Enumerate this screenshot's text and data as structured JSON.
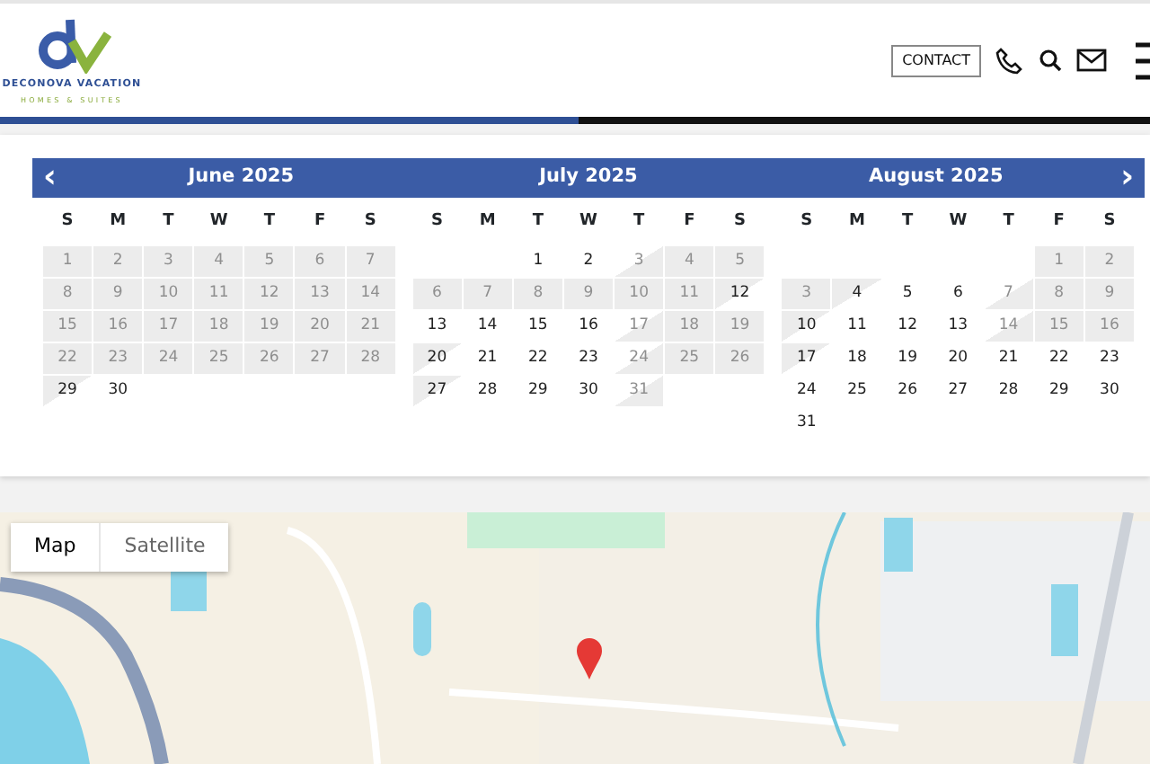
{
  "header": {
    "brand": "DECONOVA VACATION",
    "tagline": "HOMES & SUITES",
    "contact_button": "CONTACT"
  },
  "calendar": {
    "prev": "‹",
    "next": "›",
    "months": [
      {
        "title": "June 2025",
        "weekdays": [
          "S",
          "M",
          "T",
          "W",
          "T",
          "F",
          "S"
        ],
        "weeks": [
          {
            "days": [
              {
                "day": "1",
                "kind": "booked"
              },
              {
                "day": "2",
                "kind": "booked"
              },
              {
                "day": "3",
                "kind": "booked"
              },
              {
                "day": "4",
                "kind": "booked"
              },
              {
                "day": "5",
                "kind": "booked"
              },
              {
                "day": "6",
                "kind": "booked"
              },
              {
                "day": "7",
                "kind": "booked"
              }
            ]
          },
          {
            "days": [
              {
                "day": "8",
                "kind": "booked"
              },
              {
                "day": "9",
                "kind": "booked"
              },
              {
                "day": "10",
                "kind": "booked"
              },
              {
                "day": "11",
                "kind": "booked"
              },
              {
                "day": "12",
                "kind": "booked"
              },
              {
                "day": "13",
                "kind": "booked"
              },
              {
                "day": "14",
                "kind": "booked"
              }
            ]
          },
          {
            "days": [
              {
                "day": "15",
                "kind": "booked"
              },
              {
                "day": "16",
                "kind": "booked"
              },
              {
                "day": "17",
                "kind": "booked"
              },
              {
                "day": "18",
                "kind": "booked"
              },
              {
                "day": "19",
                "kind": "booked"
              },
              {
                "day": "20",
                "kind": "booked"
              },
              {
                "day": "21",
                "kind": "booked"
              }
            ]
          },
          {
            "days": [
              {
                "day": "22",
                "kind": "booked"
              },
              {
                "day": "23",
                "kind": "booked"
              },
              {
                "day": "24",
                "kind": "booked"
              },
              {
                "day": "25",
                "kind": "booked"
              },
              {
                "day": "26",
                "kind": "booked"
              },
              {
                "day": "27",
                "kind": "booked"
              },
              {
                "day": "28",
                "kind": "booked"
              }
            ]
          },
          {
            "days": [
              {
                "day": "29",
                "kind": "checkout"
              },
              {
                "day": "30",
                "kind": "available"
              }
            ]
          }
        ]
      },
      {
        "title": "July 2025",
        "weekdays": [
          "S",
          "M",
          "T",
          "W",
          "T",
          "F",
          "S"
        ],
        "weeks": [
          {
            "right_aligned": true,
            "days": [
              {
                "day": "1",
                "kind": "available"
              },
              {
                "day": "2",
                "kind": "available"
              },
              {
                "day": "3",
                "kind": "checkin"
              },
              {
                "day": "4",
                "kind": "booked"
              },
              {
                "day": "5",
                "kind": "booked"
              }
            ]
          },
          {
            "days": [
              {
                "day": "6",
                "kind": "booked"
              },
              {
                "day": "7",
                "kind": "booked"
              },
              {
                "day": "8",
                "kind": "booked"
              },
              {
                "day": "9",
                "kind": "booked"
              },
              {
                "day": "10",
                "kind": "booked"
              },
              {
                "day": "11",
                "kind": "booked"
              },
              {
                "day": "12",
                "kind": "checkout"
              }
            ]
          },
          {
            "days": [
              {
                "day": "13",
                "kind": "available"
              },
              {
                "day": "14",
                "kind": "available"
              },
              {
                "day": "15",
                "kind": "available"
              },
              {
                "day": "16",
                "kind": "available"
              },
              {
                "day": "17",
                "kind": "checkin"
              },
              {
                "day": "18",
                "kind": "booked"
              },
              {
                "day": "19",
                "kind": "booked"
              }
            ]
          },
          {
            "days": [
              {
                "day": "20",
                "kind": "checkout"
              },
              {
                "day": "21",
                "kind": "available"
              },
              {
                "day": "22",
                "kind": "available"
              },
              {
                "day": "23",
                "kind": "available"
              },
              {
                "day": "24",
                "kind": "checkin"
              },
              {
                "day": "25",
                "kind": "booked"
              },
              {
                "day": "26",
                "kind": "booked"
              }
            ]
          },
          {
            "days": [
              {
                "day": "27",
                "kind": "checkout"
              },
              {
                "day": "28",
                "kind": "available"
              },
              {
                "day": "29",
                "kind": "available"
              },
              {
                "day": "30",
                "kind": "available"
              },
              {
                "day": "31",
                "kind": "checkin"
              }
            ]
          }
        ]
      },
      {
        "title": "August 2025",
        "weekdays": [
          "S",
          "M",
          "T",
          "W",
          "T",
          "F",
          "S"
        ],
        "weeks": [
          {
            "right_aligned": true,
            "days": [
              {
                "day": "1",
                "kind": "booked"
              },
              {
                "day": "2",
                "kind": "booked"
              }
            ]
          },
          {
            "days": [
              {
                "day": "3",
                "kind": "booked"
              },
              {
                "day": "4",
                "kind": "checkout"
              },
              {
                "day": "5",
                "kind": "available"
              },
              {
                "day": "6",
                "kind": "available"
              },
              {
                "day": "7",
                "kind": "checkin"
              },
              {
                "day": "8",
                "kind": "booked"
              },
              {
                "day": "9",
                "kind": "booked"
              }
            ]
          },
          {
            "days": [
              {
                "day": "10",
                "kind": "checkout"
              },
              {
                "day": "11",
                "kind": "available"
              },
              {
                "day": "12",
                "kind": "available"
              },
              {
                "day": "13",
                "kind": "available"
              },
              {
                "day": "14",
                "kind": "checkin"
              },
              {
                "day": "15",
                "kind": "booked"
              },
              {
                "day": "16",
                "kind": "booked"
              }
            ]
          },
          {
            "days": [
              {
                "day": "17",
                "kind": "checkout"
              },
              {
                "day": "18",
                "kind": "available"
              },
              {
                "day": "19",
                "kind": "available"
              },
              {
                "day": "20",
                "kind": "available"
              },
              {
                "day": "21",
                "kind": "available"
              },
              {
                "day": "22",
                "kind": "available"
              },
              {
                "day": "23",
                "kind": "available"
              }
            ]
          },
          {
            "days": [
              {
                "day": "24",
                "kind": "available"
              },
              {
                "day": "25",
                "kind": "available"
              },
              {
                "day": "26",
                "kind": "available"
              },
              {
                "day": "27",
                "kind": "available"
              },
              {
                "day": "28",
                "kind": "available"
              },
              {
                "day": "29",
                "kind": "available"
              },
              {
                "day": "30",
                "kind": "available"
              }
            ]
          },
          {
            "days": [
              {
                "day": "31",
                "kind": "available"
              }
            ]
          }
        ]
      }
    ]
  },
  "map": {
    "kind": "picture",
    "map_types": [
      {
        "label": "Map",
        "selected": true
      },
      {
        "label": "Satellite",
        "selected": false
      }
    ]
  }
}
